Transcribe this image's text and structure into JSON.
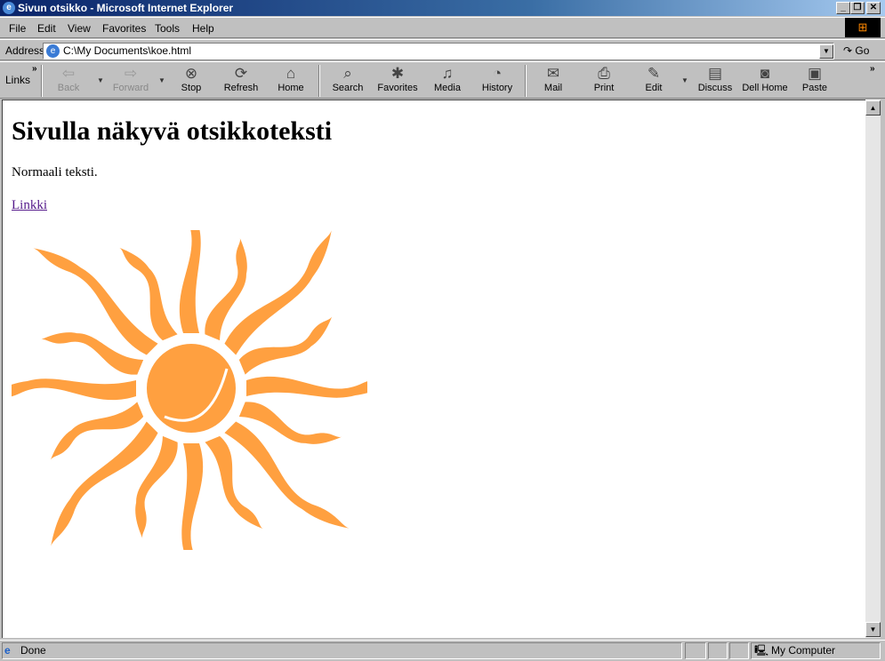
{
  "window": {
    "title": "Sivun otsikko - Microsoft Internet Explorer",
    "minimize": "_",
    "restore": "❐",
    "close": "✕"
  },
  "menu": [
    {
      "label": "File"
    },
    {
      "label": "Edit"
    },
    {
      "label": "View"
    },
    {
      "label": "Favorites"
    },
    {
      "label": "Tools"
    },
    {
      "label": "Help"
    }
  ],
  "address": {
    "label": "Address",
    "value": "C:\\My Documents\\koe.html",
    "go": "Go"
  },
  "links": {
    "label": "Links",
    "more": "»"
  },
  "toolbar": [
    {
      "label": "Back",
      "icon": "back-arrow-icon",
      "glyph": "⇦",
      "disabled": true
    },
    {
      "label": "Forward",
      "icon": "forward-arrow-icon",
      "glyph": "⇨",
      "disabled": true
    },
    {
      "label": "Stop",
      "icon": "stop-icon",
      "glyph": "⊗"
    },
    {
      "label": "Refresh",
      "icon": "refresh-icon",
      "glyph": "⟳"
    },
    {
      "label": "Home",
      "icon": "home-icon",
      "glyph": "⌂"
    },
    {
      "label": "Search",
      "icon": "search-icon",
      "glyph": "⌕"
    },
    {
      "label": "Favorites",
      "icon": "favorites-folder-icon",
      "glyph": "✱"
    },
    {
      "label": "Media",
      "icon": "media-icon",
      "glyph": "♫"
    },
    {
      "label": "History",
      "icon": "history-icon",
      "glyph": "◔"
    },
    {
      "label": "Mail",
      "icon": "mail-icon",
      "glyph": "✉"
    },
    {
      "label": "Print",
      "icon": "printer-icon",
      "glyph": "⎙"
    },
    {
      "label": "Edit",
      "icon": "edit-icon",
      "glyph": "✎"
    },
    {
      "label": "Discuss",
      "icon": "discuss-icon",
      "glyph": "▤"
    },
    {
      "label": "Dell Home",
      "icon": "dell-home-icon",
      "glyph": "◙"
    },
    {
      "label": "Paste",
      "icon": "paste-icon",
      "glyph": "▣"
    }
  ],
  "toolbar_more": "»",
  "page": {
    "heading": "Sivulla näkyvä otsikkoteksti",
    "paragraph": "Normaali teksti.",
    "link": "Linkki",
    "image_color": "#FFA040"
  },
  "status": {
    "text": "Done",
    "zone": "My Computer"
  }
}
